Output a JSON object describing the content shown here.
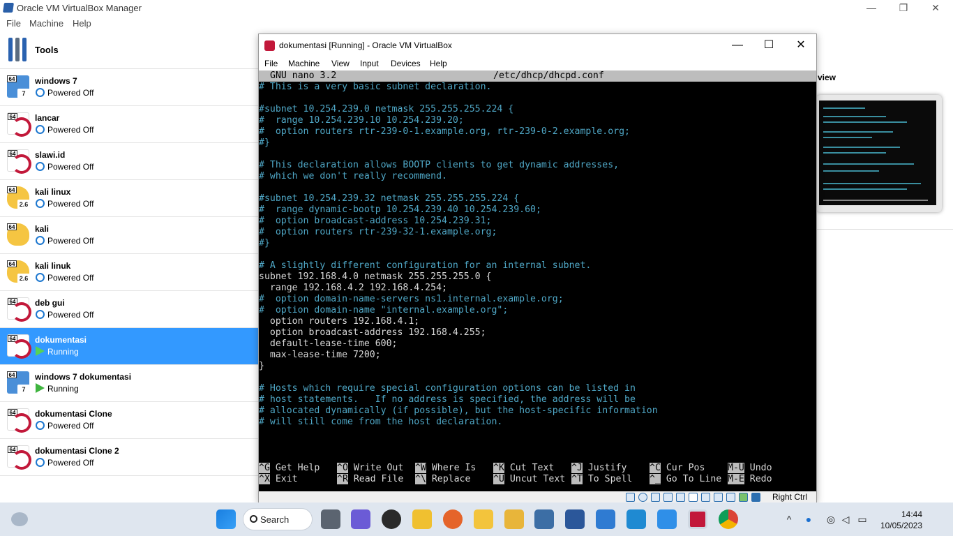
{
  "manager": {
    "title": "Oracle VM VirtualBox Manager",
    "menu": [
      "File",
      "Machine",
      "Help"
    ],
    "window_controls": {
      "minimize": "—",
      "restore": "❐",
      "close": "✕"
    }
  },
  "tools_label": "Tools",
  "vms": [
    {
      "name": "windows 7",
      "state": "Powered Off",
      "icon": "windows-icon",
      "badge": "7"
    },
    {
      "name": "lancar",
      "state": "Powered Off",
      "icon": "debian-icon",
      "badge": ""
    },
    {
      "name": "slawi.id",
      "state": "Powered Off",
      "icon": "debian-icon",
      "badge": ""
    },
    {
      "name": "kali linux",
      "state": "Powered Off",
      "icon": "kali-icon",
      "badge": "2.6"
    },
    {
      "name": "kali",
      "state": "Powered Off",
      "icon": "kali-icon",
      "badge": ""
    },
    {
      "name": "kali linuk",
      "state": "Powered Off",
      "icon": "kali-icon",
      "badge": "2.6"
    },
    {
      "name": "deb gui",
      "state": "Powered Off",
      "icon": "debian-icon",
      "badge": ""
    },
    {
      "name": "dokumentasi",
      "state": "Running",
      "icon": "debian-icon",
      "badge": "",
      "selected": true
    },
    {
      "name": "windows 7 dokumentasi",
      "state": "Running",
      "icon": "windows-icon",
      "badge": "7"
    },
    {
      "name": "dokumentasi Clone",
      "state": "Powered Off",
      "icon": "debian-icon",
      "badge": ""
    },
    {
      "name": "dokumentasi Clone 2",
      "state": "Powered Off",
      "icon": "debian-icon",
      "badge": ""
    }
  ],
  "bitness_badge": "64",
  "preview_label": "view",
  "vm_window": {
    "title": "dokumentasi [Running] - Oracle VM VirtualBox",
    "menu": [
      "File",
      "Machine",
      "View",
      "Input",
      "Devices",
      "Help"
    ],
    "host_key": "Right Ctrl"
  },
  "nano": {
    "version": "GNU nano 3.2",
    "file": "/etc/dhcp/dhcpd.conf",
    "lines": [
      {
        "row": 1,
        "text": "# This is a very basic subnet declaration.",
        "comment": true
      },
      {
        "row": 3,
        "text": "#subnet 10.254.239.0 netmask 255.255.255.224 {",
        "comment": true
      },
      {
        "row": 4,
        "text": "#  range 10.254.239.10 10.254.239.20;",
        "comment": true
      },
      {
        "row": 5,
        "text": "#  option routers rtr-239-0-1.example.org, rtr-239-0-2.example.org;",
        "comment": true
      },
      {
        "row": 6,
        "text": "#}",
        "comment": true
      },
      {
        "row": 8,
        "text": "# This declaration allows BOOTP clients to get dynamic addresses,",
        "comment": true
      },
      {
        "row": 9,
        "text": "# which we don't really recommend.",
        "comment": true
      },
      {
        "row": 11,
        "text": "#subnet 10.254.239.32 netmask 255.255.255.224 {",
        "comment": true
      },
      {
        "row": 12,
        "text": "#  range dynamic-bootp 10.254.239.40 10.254.239.60;",
        "comment": true
      },
      {
        "row": 13,
        "text": "#  option broadcast-address 10.254.239.31;",
        "comment": true
      },
      {
        "row": 14,
        "text": "#  option routers rtr-239-32-1.example.org;",
        "comment": true
      },
      {
        "row": 15,
        "text": "#}",
        "comment": true
      },
      {
        "row": 17,
        "text": "# A slightly different configuration for an internal subnet.",
        "comment": true
      },
      {
        "row": 18,
        "text": "subnet 192.168.4.0 netmask 255.255.255.0 {",
        "comment": false
      },
      {
        "row": 19,
        "text": "  range 192.168.4.2 192.168.4.254;",
        "comment": false
      },
      {
        "row": 20,
        "text": "#  option domain-name-servers ns1.internal.example.org;",
        "comment": true
      },
      {
        "row": 21,
        "text": "#  option domain-name \"internal.example.org\";",
        "comment": true
      },
      {
        "row": 22,
        "text": "  option routers 192.168.4.1;",
        "comment": false
      },
      {
        "row": 23,
        "text": "  option broadcast-address 192.168.4.255;",
        "comment": false
      },
      {
        "row": 24,
        "text": "  default-lease-time 600;",
        "comment": false
      },
      {
        "row": 25,
        "text": "  max-lease-time 7200;",
        "comment": false
      },
      {
        "row": 26,
        "text": "}",
        "comment": false
      },
      {
        "row": 28,
        "text": "# Hosts which require special configuration options can be listed in",
        "comment": true
      },
      {
        "row": 29,
        "text": "# host statements.   If no address is specified, the address will be",
        "comment": true
      },
      {
        "row": 30,
        "text": "# allocated dynamically (if possible), but the host-specific information",
        "comment": true
      },
      {
        "row": 31,
        "text": "# will still come from the host declaration.",
        "comment": true
      }
    ],
    "shortcuts": [
      {
        "key": "^G",
        "label": "Get Help"
      },
      {
        "key": "^O",
        "label": "Write Out"
      },
      {
        "key": "^W",
        "label": "Where Is"
      },
      {
        "key": "^K",
        "label": "Cut Text"
      },
      {
        "key": "^J",
        "label": "Justify"
      },
      {
        "key": "^C",
        "label": "Cur Pos"
      },
      {
        "key": "M-U",
        "label": "Undo"
      },
      {
        "key": "^X",
        "label": "Exit"
      },
      {
        "key": "^R",
        "label": "Read File"
      },
      {
        "key": "^\\",
        "label": "Replace"
      },
      {
        "key": "^U",
        "label": "Uncut Text"
      },
      {
        "key": "^T",
        "label": "To Spell"
      },
      {
        "key": "^_",
        "label": "Go To Line"
      },
      {
        "key": "M-E",
        "label": "Redo"
      }
    ]
  },
  "taskbar": {
    "search_label": "Search",
    "time": "14:44",
    "date": "10/05/2023"
  },
  "colors": {
    "selection": "#3399ff",
    "nano_comment": "#4fa7c6",
    "nano_text": "#d8d8d8",
    "terminal_bg": "#000000"
  }
}
